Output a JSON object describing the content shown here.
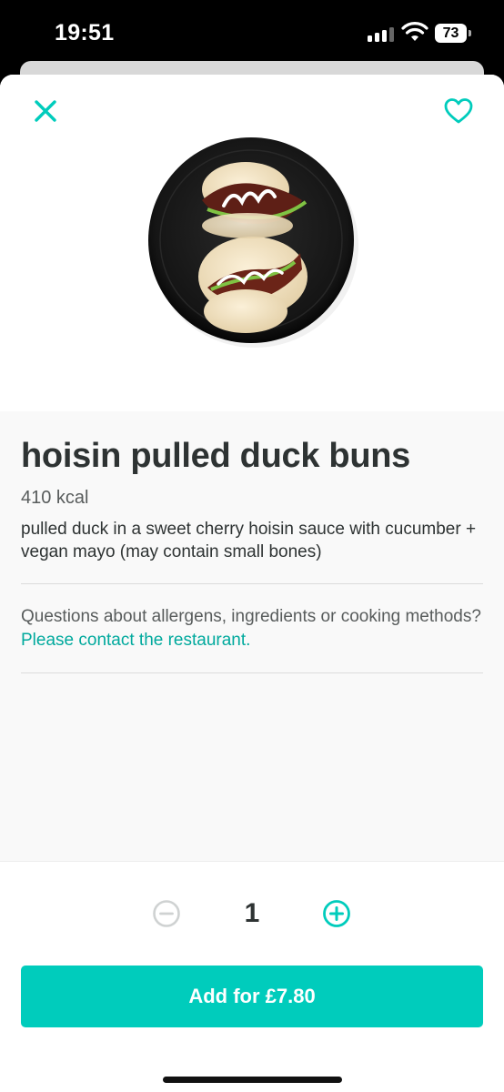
{
  "status_bar": {
    "time": "19:51",
    "battery_level": "73",
    "signal_bars_active": 3,
    "signal_bars_total": 4,
    "icons": [
      "signal-icon",
      "wifi-icon",
      "battery-icon"
    ]
  },
  "header": {
    "close_icon": "close-icon",
    "favourite_icon": "heart-outline-icon",
    "accent_color": "#00ccbc"
  },
  "item": {
    "title": "hoisin pulled duck buns",
    "calories": "410 kcal",
    "description": "pulled duck in a sweet cherry hoisin sauce with cucumber + vegan mayo  (may contain small bones)"
  },
  "allergen_info": {
    "text": "Questions about allergens, ingredients or cooking methods? ",
    "link_text": "Please contact the restaurant."
  },
  "order": {
    "quantity": "1",
    "minus_icon": "minus-circle-icon",
    "plus_icon": "plus-circle-icon",
    "add_button_label": "Add for £7.80",
    "button_color": "#00ccbc"
  }
}
